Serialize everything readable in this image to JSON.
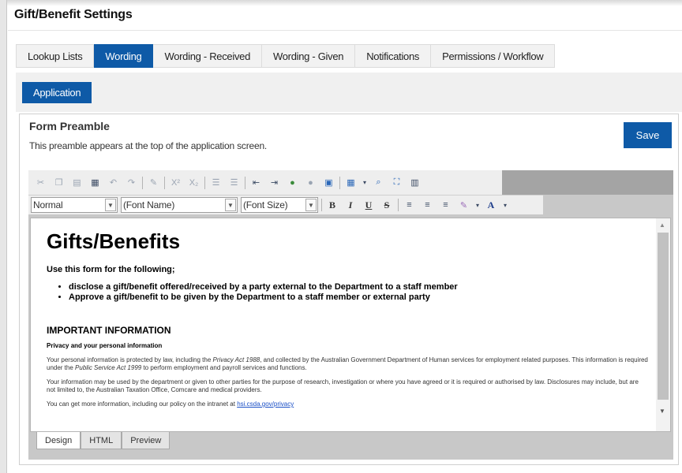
{
  "page": {
    "title": "Gift/Benefit Settings"
  },
  "main_tabs": [
    {
      "label": "Lookup Lists",
      "active": false
    },
    {
      "label": "Wording",
      "active": true
    },
    {
      "label": "Wording - Received",
      "active": false
    },
    {
      "label": "Wording - Given",
      "active": false
    },
    {
      "label": "Notifications",
      "active": false
    },
    {
      "label": "Permissions / Workflow",
      "active": false
    }
  ],
  "sub_tabs": [
    {
      "label": "Application",
      "active": true
    }
  ],
  "section": {
    "title": "Form Preamble",
    "description": "This preamble appears at the top of the application screen.",
    "save_label": "Save"
  },
  "toolbar": {
    "format_value": "Normal",
    "font_name_value": "(Font Name)",
    "font_size_value": "(Font Size)",
    "bold": "B",
    "italic": "I",
    "underline": "U",
    "strike": "S",
    "superscript": "X²",
    "subscript": "X₂",
    "text_color": "A"
  },
  "document": {
    "heading": "Gifts/Benefits",
    "lead": "Use this form for the following;",
    "bullets": [
      "disclose a gift/benefit offered/received by a party external to the Department to a staff member",
      "Approve a gift/benefit to be given by the Department to a staff member or external party"
    ],
    "important_heading": "IMPORTANT INFORMATION",
    "privacy_heading": "Privacy and your personal information",
    "p1": {
      "a": "Your personal information is protected by law, including the ",
      "b": "Privacy Act 1988",
      "c": ", and collected by the Australian Government Department of Human services for employment related purposes. This information is required under the ",
      "d": "Public Service Act 1999",
      "e": " to perform employment and payroll services and functions."
    },
    "p2": "Your information may be used by the department or given to other parties for the purpose of research, investigation or where you have agreed or it is required or authorised by law. Disclosures may include, but are not limited to, the Australian Taxation Office, Comcare and medical providers.",
    "p3_text": "You can get more information, including our policy on the intranet at ",
    "p3_link": "hsi.csda.gov/privacy"
  },
  "editor_modes": [
    {
      "label": "Design",
      "active": true
    },
    {
      "label": "HTML",
      "active": false
    },
    {
      "label": "Preview",
      "active": false
    }
  ],
  "colors": {
    "accent": "#0e5aa7",
    "link": "#1a4fc6"
  }
}
